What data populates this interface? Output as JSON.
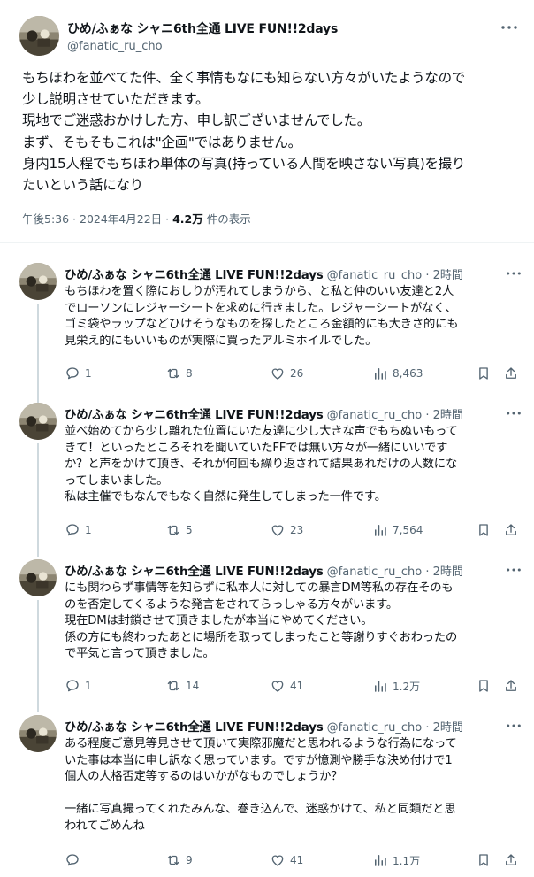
{
  "main": {
    "display_name": "ひめ/ふぁな シャニ6th全通 LIVE FUN!!2days",
    "handle": "@fanatic_ru_cho",
    "text": "もちほわを並べてた件、全く事情もなにも知らない方々がいたようなので\n少し説明させていただきます。\n現地でご迷惑おかけした方、申し訳ございませんでした。\nまず、そもそもこれは\"企画\"ではありません。\n身内15人程でもちほわ単体の写真(持っている人間を映さない写真)を撮り\nたいという話になり",
    "time": "午後5:36 · 2024年4月22日 · ",
    "views": "4.2万",
    "views_suffix": " 件の表示"
  },
  "replies": [
    {
      "display_name": "ひめ/ふぁな シャニ6th全通 LIVE FUN!!2days",
      "handle": "@fanatic_ru_cho · 2時間",
      "text": "もちほわを置く際におしりが汚れてしまうから、と私と仲のいい友達と2人\nでローソンにレジャーシートを求めに行きました。レジャーシートがなく、\nゴミ袋やラップなどひけそうなものを探したところ金額的にも大きさ的にも\n見栄え的にもいいものが実際に買ったアルミホイルでした。",
      "reply_count": "1",
      "repost_count": "8",
      "like_count": "26",
      "view_count": "8,463"
    },
    {
      "display_name": "ひめ/ふぁな シャニ6th全通 LIVE FUN!!2days",
      "handle": "@fanatic_ru_cho · 2時間",
      "text": "並べ始めてから少し離れた位置にいた友達に少し大きな声でもちぬいもって\nきて！といったところそれを聞いていたFFでは無い方々が一緒にいいです\nか？と声をかけて頂き、それが何回も繰り返されて結果あれだけの人数にな\nってしまいました。\n私は主催でもなんでもなく自然に発生してしまった一件です。",
      "reply_count": "1",
      "repost_count": "5",
      "like_count": "23",
      "view_count": "7,564"
    },
    {
      "display_name": "ひめ/ふぁな シャニ6th全通 LIVE FUN!!2days",
      "handle": "@fanatic_ru_cho · 2時間",
      "text": "にも関わらず事情等を知らずに私本人に対しての暴言DM等私の存在そのも\nのを否定してくるような発言をされてらっしゃる方々がいます。\n現在DMは封鎖させて頂きましたが本当にやめてください。\n係の方にも終わったあとに場所を取ってしまったこと等謝りすぐおわったの\nで平気と言って頂きました。",
      "reply_count": "1",
      "repost_count": "14",
      "like_count": "41",
      "view_count": "1.2万"
    },
    {
      "display_name": "ひめ/ふぁな シャニ6th全通 LIVE FUN!!2days",
      "handle": "@fanatic_ru_cho · 2時間",
      "text": "ある程度ご意見等見させて頂いて実際邪魔だと思われるような行為になって\nいた事は本当に申し訳なく思っています。ですが憶測や勝手な決め付けで1\n個人の人格否定等するのはいかがなものでしょうか？\n\n一緒に写真撮ってくれたみんな、巻き込んで、迷惑かけて、私と同類だと思\nわれてごめんね",
      "reply_count": "",
      "repost_count": "9",
      "like_count": "41",
      "view_count": "1.1万"
    }
  ],
  "icons": [
    "more-icon",
    "reply-icon",
    "repost-icon",
    "like-icon",
    "views-icon",
    "bookmark-icon",
    "share-icon"
  ],
  "colors": {
    "text": "#0f1419",
    "secondary": "#536471",
    "divider": "#eff3f4",
    "thread_line": "#cfd9de"
  }
}
